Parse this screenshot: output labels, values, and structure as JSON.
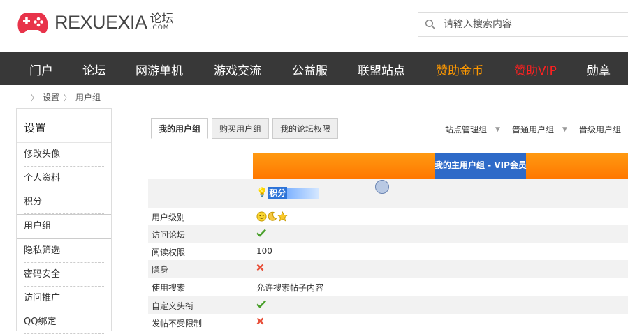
{
  "brand": {
    "logo_text": "REXUEXIA",
    "logo_cn": "论坛",
    "logo_com": ".COM"
  },
  "search": {
    "placeholder": "请输入搜索内容"
  },
  "nav": {
    "items": [
      "门户",
      "论坛",
      "网游单机",
      "游戏交流",
      "公益服",
      "联盟站点",
      "赞助金币",
      "赞助VIP",
      "勋章"
    ],
    "colors": {
      "default": "#ffffff",
      "gold": "#ff9900",
      "vip": "#ff2020"
    }
  },
  "breadcrumb": [
    "设置",
    "用户组"
  ],
  "sidebar": {
    "title": "设置",
    "items": [
      "修改头像",
      "个人资料",
      "积分",
      "用户组",
      "隐私筛选",
      "密码安全",
      "访问推广",
      "QQ绑定"
    ],
    "active_index": 3
  },
  "tabs": [
    "我的用户组",
    "购买用户组",
    "我的论坛权限"
  ],
  "groups": [
    "站点管理组",
    "普通用户组",
    "晋级用户组"
  ],
  "table": {
    "header": "我的主用户组 - VIP会员",
    "points_label": "积分",
    "rows": [
      {
        "label": "用户级别",
        "value": "",
        "icon": "level-icons"
      },
      {
        "label": "访问论坛",
        "value": "",
        "icon": "check-icon"
      },
      {
        "label": "阅读权限",
        "value": "100",
        "icon": ""
      },
      {
        "label": "隐身",
        "value": "",
        "icon": "cross-icon"
      },
      {
        "label": "使用搜索",
        "value": "允许搜索帖子内容",
        "icon": ""
      },
      {
        "label": "自定义头衔",
        "value": "",
        "icon": "check-icon"
      },
      {
        "label": "发帖不受限制",
        "value": "",
        "icon": "cross-icon"
      }
    ]
  }
}
